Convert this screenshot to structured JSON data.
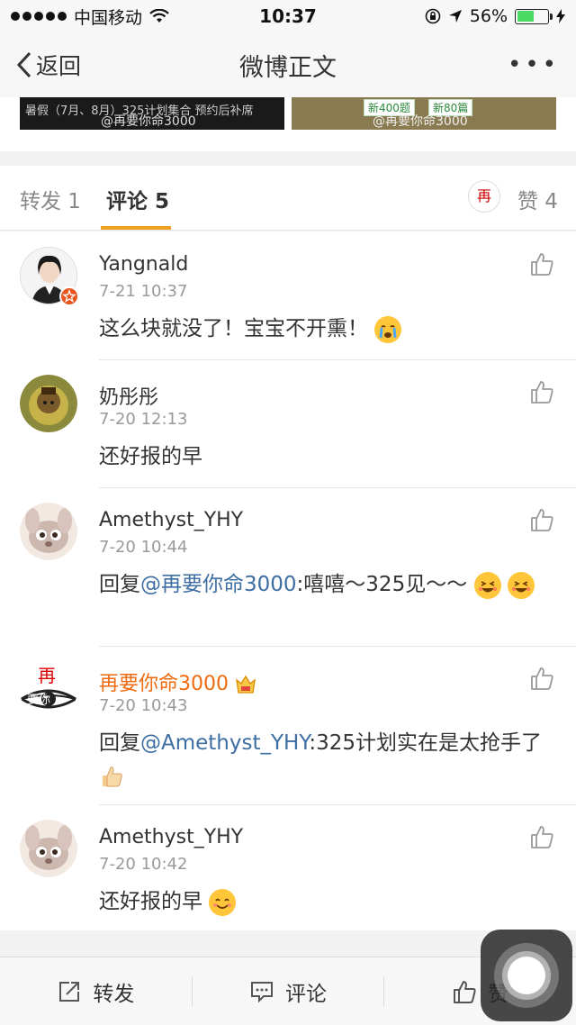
{
  "status_bar": {
    "carrier": "中国移动",
    "time": "10:37",
    "battery": "56%",
    "battery_level": 0.56
  },
  "nav": {
    "back_label": "返回",
    "title": "微博正文",
    "more_label": "•••"
  },
  "image_strip": {
    "img1_text": "暑假（7月、8月）325计划集合   预约后补席",
    "img1_watermark": "@再要你命3000",
    "img2_tag1": "新400题",
    "img2_tag2": "新80篇",
    "img2_watermark": "@再要你命3000"
  },
  "tabs": {
    "repost": "转发 1",
    "comment": "评论 5",
    "like": "赞 4"
  },
  "comments": [
    {
      "user": "Yangnald",
      "time": "7-21 10:37",
      "text": "这么块就没了！宝宝不开熏！"
    },
    {
      "user": "奶彤彤",
      "time": "7-20 12:13",
      "text": "还好报的早"
    },
    {
      "user": "Amethyst_YHY",
      "time": "7-20 10:44",
      "prefix": "回复",
      "mention": "@再要你命3000",
      "text": ":嘻嘻～325见～～"
    },
    {
      "user": "再要你命3000",
      "time": "7-20 10:43",
      "prefix": "回复",
      "mention": "@Amethyst_YHY",
      "text": ":325计划实在是太抢手了"
    },
    {
      "user": "Amethyst_YHY",
      "time": "7-20 10:42",
      "text": "还好报的早"
    }
  ],
  "avatar_text": {
    "zai_top": "再",
    "zai_bottom": "要你"
  },
  "bottom_bar": {
    "repost": "转发",
    "comment": "评论",
    "like": "赞"
  },
  "colors": {
    "accent": "#f0a020",
    "mention": "#3d6ea3",
    "username_highlight": "#f06a10"
  },
  "icons": [
    "wifi-icon",
    "lock-rotation-icon",
    "location-arrow-icon",
    "charging-icon",
    "back-chevron-icon",
    "thumb-up-icon",
    "share-icon",
    "comment-icon",
    "assistive-touch-icon"
  ]
}
